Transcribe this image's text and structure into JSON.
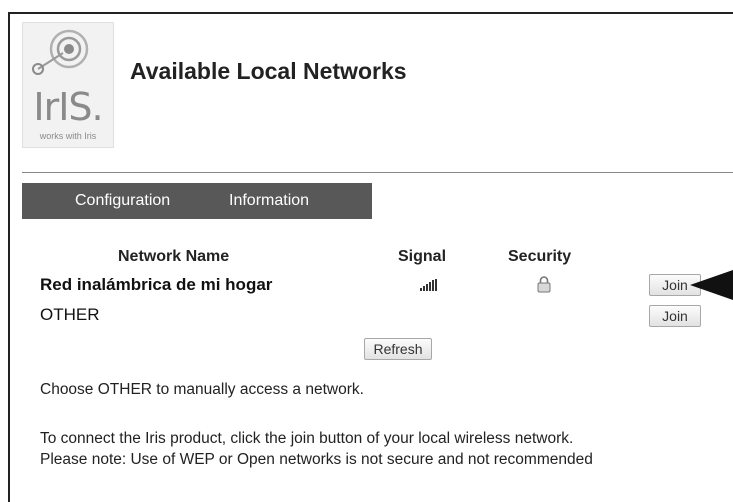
{
  "logo": {
    "wordmark": "IrIS.",
    "tagline": "works with Iris"
  },
  "header": {
    "title": "Available Local Networks"
  },
  "tabs": [
    "Configuration",
    "Information"
  ],
  "table": {
    "headers": {
      "name": "Network Name",
      "signal": "Signal",
      "security": "Security"
    },
    "rows": [
      {
        "name": "Red inalámbrica de mi hogar",
        "signal_icon": "signal-bars-icon",
        "security_icon": "lock-icon",
        "action": "Join"
      },
      {
        "name": "OTHER",
        "action": "Join"
      }
    ]
  },
  "refresh_label": "Refresh",
  "instructions": {
    "other": "Choose OTHER to manually access a network.",
    "line1": "To connect the Iris product, click the join button of your local wireless network.",
    "line2": "Please note: Use of WEP or Open networks is not secure and not recommended"
  },
  "colors": {
    "tabbar": "#585858",
    "frame": "#222222"
  }
}
